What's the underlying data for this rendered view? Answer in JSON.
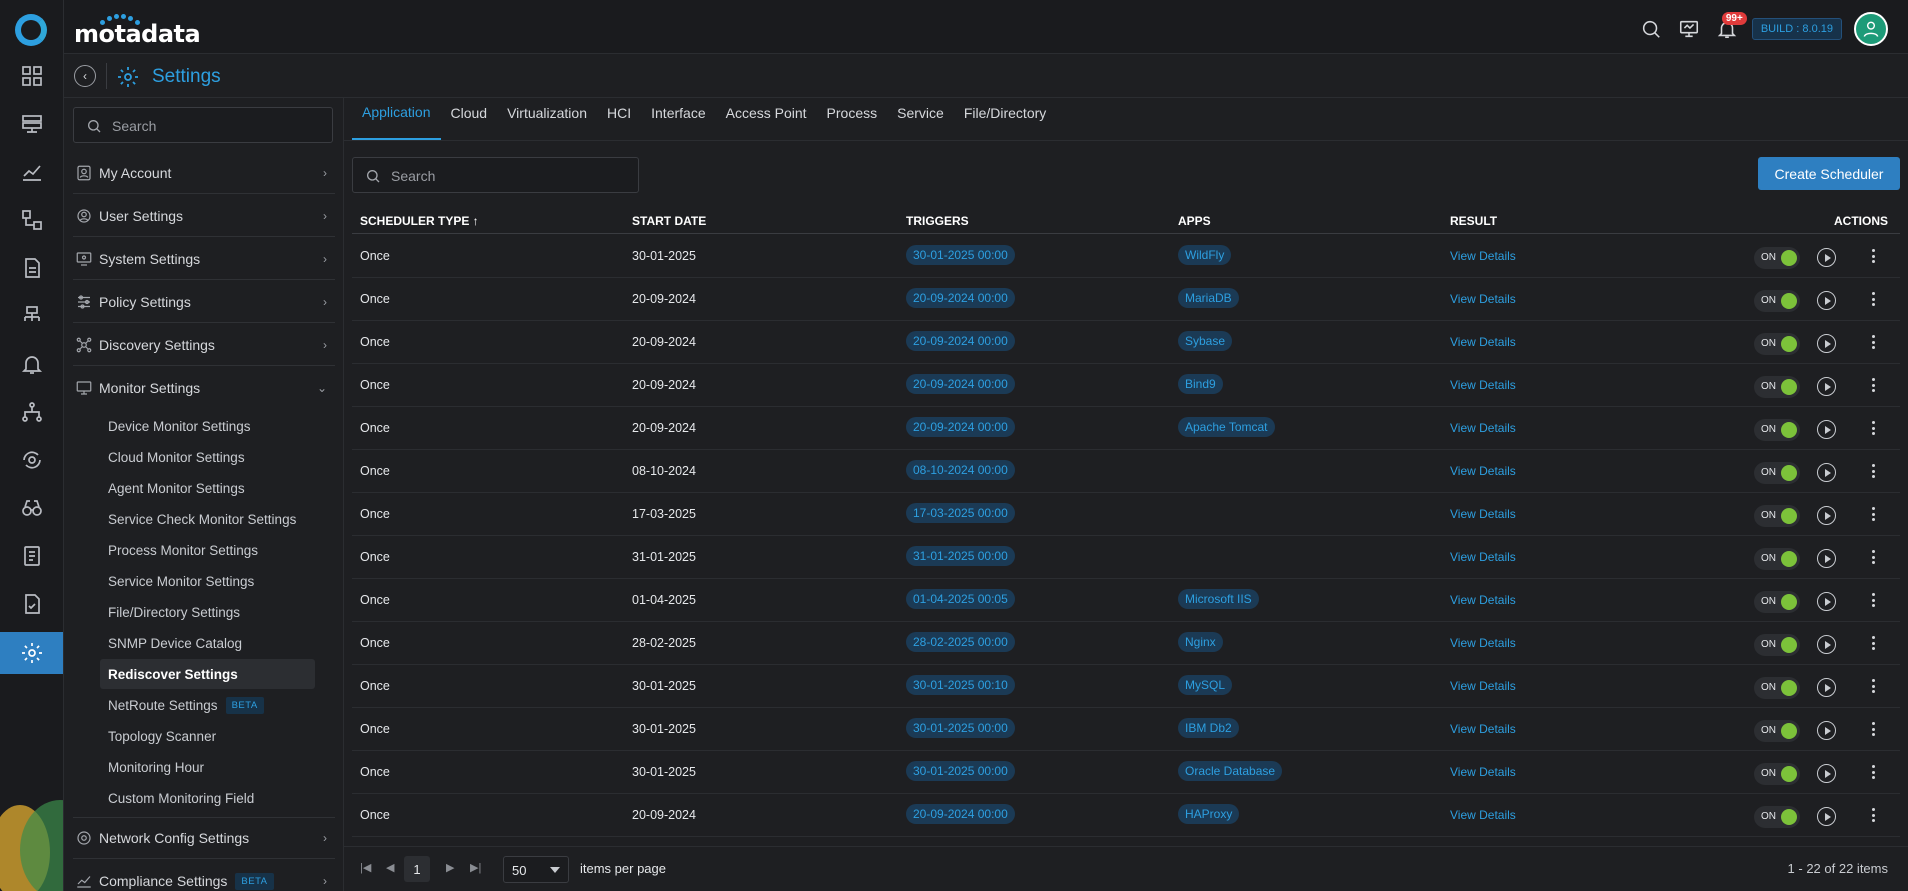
{
  "app": {
    "brand": "motadata",
    "build": "BUILD : 8.0.19",
    "notifications": "99+"
  },
  "page": {
    "title": "Settings"
  },
  "sidebar": {
    "search_placeholder": "Search",
    "sections": [
      {
        "label": "My Account",
        "icon": "account-icon"
      },
      {
        "label": "User Settings",
        "icon": "user-settings-icon"
      },
      {
        "label": "System Settings",
        "icon": "system-settings-icon"
      },
      {
        "label": "Policy Settings",
        "icon": "policy-settings-icon"
      },
      {
        "label": "Discovery Settings",
        "icon": "discovery-settings-icon"
      },
      {
        "label": "Monitor Settings",
        "icon": "monitor-settings-icon"
      }
    ],
    "monitor_items": [
      "Device Monitor Settings",
      "Cloud Monitor Settings",
      "Agent Monitor Settings",
      "Service Check Monitor Settings",
      "Process Monitor Settings",
      "Service Monitor Settings",
      "File/Directory Settings",
      "SNMP Device Catalog",
      "Rediscover Settings",
      "NetRoute Settings",
      "Topology Scanner",
      "Monitoring Hour",
      "Custom Monitoring Field"
    ],
    "beta_label": "BETA",
    "bottom_sections": [
      {
        "label": "Network Config Settings",
        "icon": "network-config-icon"
      },
      {
        "label": "Compliance Settings",
        "icon": "compliance-icon"
      }
    ]
  },
  "tabs": [
    "Application",
    "Cloud",
    "Virtualization",
    "HCI",
    "Interface",
    "Access Point",
    "Process",
    "Service",
    "File/Directory"
  ],
  "toolbar": {
    "search_placeholder": "Search",
    "create_label": "Create Scheduler"
  },
  "table": {
    "headers": {
      "type": "SCHEDULER TYPE ↑",
      "start": "START DATE",
      "triggers": "TRIGGERS",
      "apps": "APPS",
      "result": "RESULT",
      "actions": "ACTIONS"
    },
    "toggle_label": "ON",
    "result_label": "View Details",
    "rows": [
      {
        "type": "Once",
        "start": "30-01-2025",
        "trigger": "30-01-2025 00:00",
        "app": "WildFly"
      },
      {
        "type": "Once",
        "start": "20-09-2024",
        "trigger": "20-09-2024 00:00",
        "app": "MariaDB"
      },
      {
        "type": "Once",
        "start": "20-09-2024",
        "trigger": "20-09-2024 00:00",
        "app": "Sybase"
      },
      {
        "type": "Once",
        "start": "20-09-2024",
        "trigger": "20-09-2024 00:00",
        "app": "Bind9"
      },
      {
        "type": "Once",
        "start": "20-09-2024",
        "trigger": "20-09-2024 00:00",
        "app": "Apache Tomcat"
      },
      {
        "type": "Once",
        "start": "08-10-2024",
        "trigger": "08-10-2024 00:00",
        "app": ""
      },
      {
        "type": "Once",
        "start": "17-03-2025",
        "trigger": "17-03-2025 00:00",
        "app": ""
      },
      {
        "type": "Once",
        "start": "31-01-2025",
        "trigger": "31-01-2025 00:00",
        "app": ""
      },
      {
        "type": "Once",
        "start": "01-04-2025",
        "trigger": "01-04-2025 00:05",
        "app": "Microsoft IIS"
      },
      {
        "type": "Once",
        "start": "28-02-2025",
        "trigger": "28-02-2025 00:00",
        "app": "Nginx"
      },
      {
        "type": "Once",
        "start": "30-01-2025",
        "trigger": "30-01-2025 00:10",
        "app": "MySQL"
      },
      {
        "type": "Once",
        "start": "30-01-2025",
        "trigger": "30-01-2025 00:00",
        "app": "IBM Db2"
      },
      {
        "type": "Once",
        "start": "30-01-2025",
        "trigger": "30-01-2025 00:00",
        "app": "Oracle Database"
      },
      {
        "type": "Once",
        "start": "20-09-2024",
        "trigger": "20-09-2024 00:00",
        "app": "HAProxy"
      }
    ]
  },
  "pager": {
    "page": "1",
    "page_size": "50",
    "items_per_page": "items per page",
    "range": "1 - 22 of 22 items"
  }
}
